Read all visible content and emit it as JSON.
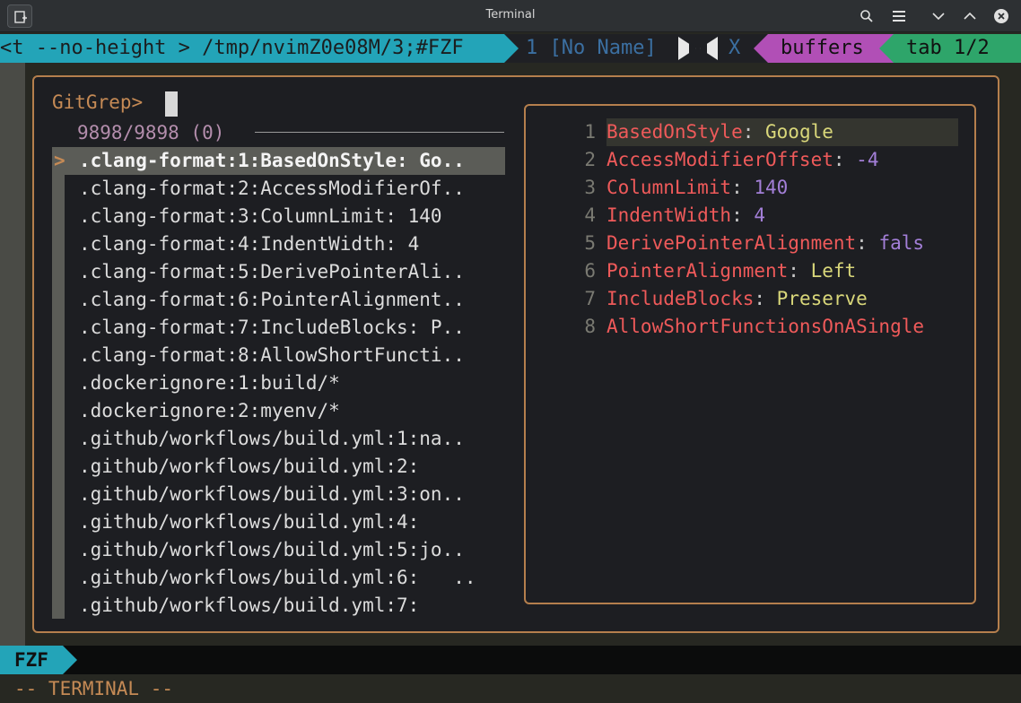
{
  "window": {
    "title": "Terminal"
  },
  "tabline": {
    "current": "<t --no-height > /tmp/nvimZ0e08M/3;#FZF",
    "buffer_name": "1 [No Name]",
    "close": "X",
    "buffers_label": "buffers",
    "tab_label": "tab 1/2"
  },
  "fzf": {
    "prompt": "GitGrep>",
    "count": "9898/9898 (0)",
    "pointer": ">",
    "results": [
      ".clang-format:1:BasedOnStyle: Go..",
      ".clang-format:2:AccessModifierOf..",
      ".clang-format:3:ColumnLimit: 140",
      ".clang-format:4:IndentWidth: 4",
      ".clang-format:5:DerivePointerAli..",
      ".clang-format:6:PointerAlignment..",
      ".clang-format:7:IncludeBlocks: P..",
      ".clang-format:8:AllowShortFuncti..",
      ".dockerignore:1:build/*",
      ".dockerignore:2:myenv/*",
      ".github/workflows/build.yml:1:na..",
      ".github/workflows/build.yml:2:",
      ".github/workflows/build.yml:3:on..",
      ".github/workflows/build.yml:4:",
      ".github/workflows/build.yml:5:jo..",
      ".github/workflows/build.yml:6:   ..",
      ".github/workflows/build.yml:7:"
    ],
    "selected_index": 0
  },
  "preview": {
    "lines": [
      {
        "num": "1",
        "key": "BasedOnStyle",
        "sep": ": ",
        "value": "Google",
        "vtype": "str"
      },
      {
        "num": "2",
        "key": "AccessModifierOffset",
        "sep": ": ",
        "value": "-4",
        "vtype": "num"
      },
      {
        "num": "3",
        "key": "ColumnLimit",
        "sep": ": ",
        "value": "140",
        "vtype": "num"
      },
      {
        "num": "4",
        "key": "IndentWidth",
        "sep": ": ",
        "value": "4",
        "vtype": "num"
      },
      {
        "num": "5",
        "key": "DerivePointerAlignment",
        "sep": ": ",
        "value": "fals",
        "vtype": "num"
      },
      {
        "num": "6",
        "key": "PointerAlignment",
        "sep": ": ",
        "value": "Left",
        "vtype": "str"
      },
      {
        "num": "7",
        "key": "IncludeBlocks",
        "sep": ": ",
        "value": "Preserve",
        "vtype": "str"
      },
      {
        "num": "8",
        "key": "AllowShortFunctionsOnASingle",
        "sep": "",
        "value": "",
        "vtype": "str"
      }
    ]
  },
  "statusline": {
    "mode": "FZF"
  },
  "cmdline": {
    "text": "-- TERMINAL --"
  },
  "colors": {
    "accent_cyan": "#23a4b8",
    "accent_magenta": "#b14fb6",
    "accent_green": "#2ea56a",
    "border_orange": "#b57f4d"
  }
}
